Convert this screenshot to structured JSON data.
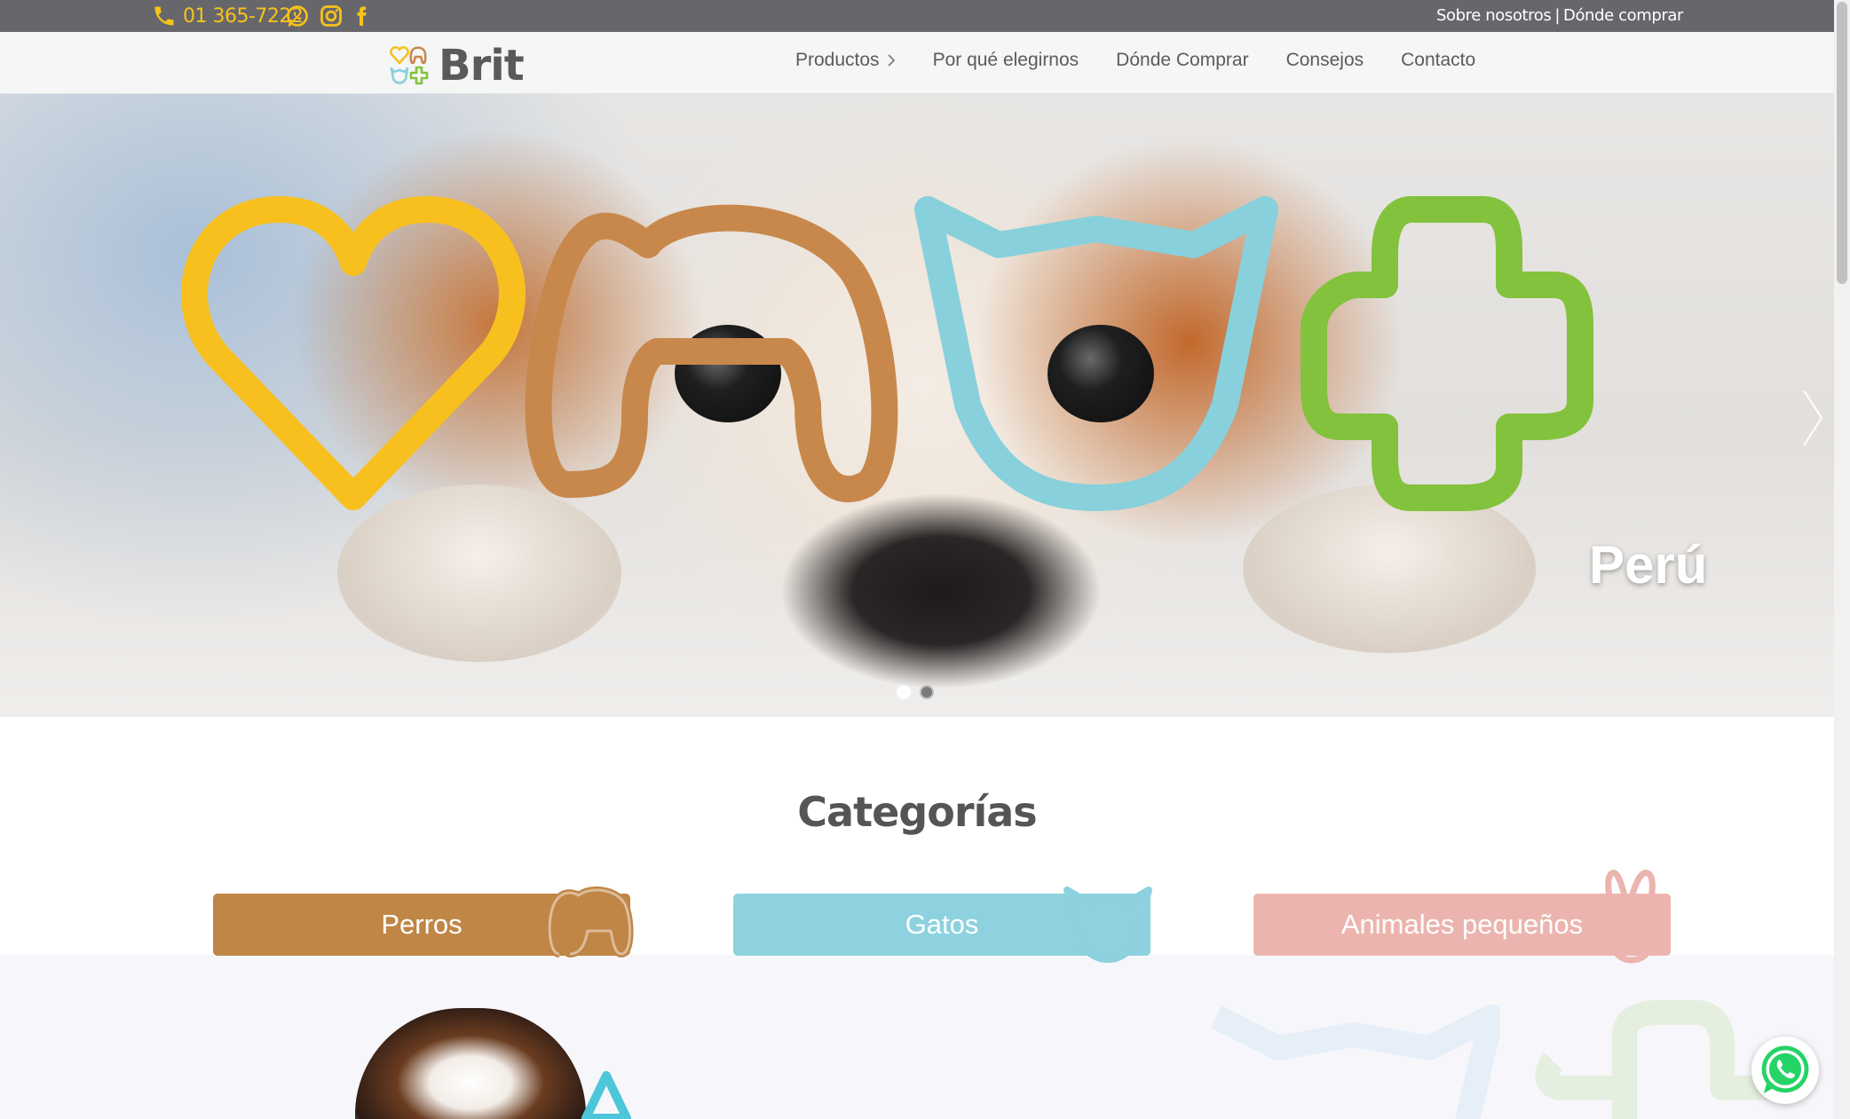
{
  "topbar": {
    "phone": "01 365-7222",
    "links": [
      "Sobre nosotros",
      "Dónde comprar"
    ],
    "separator": "|",
    "accent_color": "#f7c21a",
    "social_icons": [
      "whatsapp-icon",
      "instagram-icon",
      "facebook-icon"
    ]
  },
  "header": {
    "logo_text": "Brit",
    "nav": {
      "productos": "Productos",
      "por_que": "Por qué elegirnos",
      "donde": "Dónde Comprar",
      "consejos": "Consejos",
      "contacto": "Contacto"
    }
  },
  "hero": {
    "caption": "Perú",
    "slides_total": 2,
    "active_slide": 1,
    "shape_colors": {
      "heart": "#f7c01f",
      "dog": "#c8884c",
      "cat": "#88d0dc",
      "cross": "#82c23c"
    }
  },
  "categories": {
    "title": "Categorías",
    "items": [
      {
        "label": "Perros",
        "color": "#c08646"
      },
      {
        "label": "Gatos",
        "color": "#8dd2de"
      },
      {
        "label": "Animales pequeños",
        "color": "#ebb4ae"
      }
    ]
  }
}
